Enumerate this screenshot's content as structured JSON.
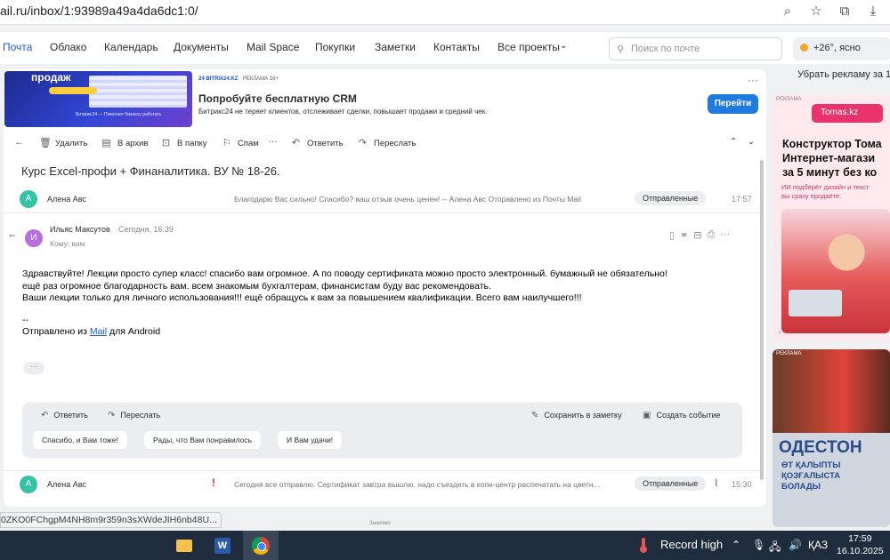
{
  "browser": {
    "url": "ail.ru/inbox/1:93989a49a4da6dc1:0/",
    "icons": [
      "zoom-icon",
      "star-icon",
      "extensions-icon",
      "download-icon"
    ]
  },
  "nav": {
    "items": [
      "Почта",
      "Облако",
      "Календарь",
      "Документы",
      "Mail Space",
      "Покупки",
      "Заметки",
      "Контакты",
      "Все проекты"
    ],
    "search_placeholder": "Поиск по почте",
    "weather": "+26°, ясно"
  },
  "ad_banner": {
    "image_text": "продаж",
    "image_caption": "Битрикс24 — Помогает бизнесу работать",
    "source": "24 BITRIX24.KZ",
    "label": "РЕКЛАМА 16+",
    "title": "Попробуйте бесплатную CRM",
    "description": "Битрикс24 не теряет клиентов, отслеживает сделки, повышает продажи и средний чек.",
    "button": "Перейти"
  },
  "toolbar": {
    "delete": "Удалить",
    "archive": "В архив",
    "to_folder": "В папку",
    "spam": "Спам",
    "reply": "Ответить",
    "forward": "Переслать"
  },
  "thread": {
    "subject": "Курс Excel-профи + Финаналитика. ВУ № 18-26."
  },
  "collapsed_messages": [
    {
      "initial": "А",
      "sender": "Алена Авс",
      "snippet": "Благодарю Вас сильно! Спасибо? ваш отзыв очень ценен! -- Алена Авс Отправлено из Почты Mail",
      "folder": "Отправленные",
      "time": "17:57"
    },
    {
      "initial": "А",
      "sender": "Алена Авс",
      "important": "!",
      "snippet": "Сегодня все отправлю. Сертификат завтра вышлю. надо съездить в копи-центр распечатать на цветн...",
      "folder": "Отправленные",
      "time": "15:30"
    }
  ],
  "open_message": {
    "initial": "И",
    "sender": "Ильяс Максутов",
    "date": "Сегодня, 16:39",
    "to": "Кому: вам",
    "body_lines": [
      "Здравствуйте! Лекции просто супер класс! спасибо вам огромное. А по поводу сертификата можно просто электронный. бумажный не обязательно!",
      "ещё раз огромное благодарность вам. всем знакомым бухгалтерам, финансистам буду вас рекомендовать.",
      "Ваши лекции только для личного использования!!! ещё обращусь к вам за повышением квалификации. Всего вам наилучшего!!!"
    ],
    "signature_sep": "--",
    "signature_prefix": "Отправлено из",
    "signature_link": "Mail",
    "signature_suffix": "для Android",
    "ellipsis": "···"
  },
  "reply_box": {
    "reply": "Ответить",
    "forward": "Переслать",
    "save_note": "Сохранить в заметку",
    "create_event": "Создать событие",
    "quick_replies": [
      "Спасибо, и Вам тоже!",
      "Рады, что Вам понравилось",
      "И Вам удачи!"
    ]
  },
  "right_ads": {
    "remove_ads": "Убрать рекламу за 1",
    "ad1": {
      "label": "РЕКЛАМА",
      "logo": "Tomas.kz",
      "headline": [
        "Конструктор Тома",
        "Интернет-магази",
        "за 5 минут без ко"
      ],
      "subline": [
        "ИИ подберёт дизайн и текст",
        "вы сразу продаёте."
      ]
    },
    "ad2": {
      "label": "РЕКЛАМА",
      "brand": "ОДЕСТОН",
      "subline": [
        "ӨТ ҚАЛЫПТЫ",
        "ҚОЗҒАЛЫСТА",
        "БОЛАДЫ"
      ]
    }
  },
  "status_url": "0ZKO0FChgpM4NH8m9r359n3sXWdeJIH6nb48U...",
  "footer_caption": "Знакомо",
  "taskbar": {
    "weather": "Record high",
    "lang": "ҚАЗ",
    "time": "17:59",
    "date": "16.10.2025"
  }
}
